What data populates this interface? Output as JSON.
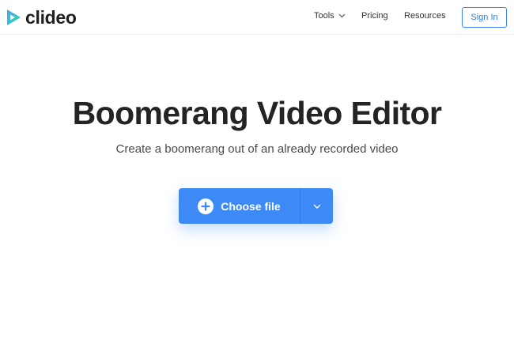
{
  "header": {
    "logo": {
      "text": "clideo",
      "icon": "play-triangle-logo-icon"
    },
    "nav": [
      {
        "label": "Tools",
        "icon": "chevron-down-icon"
      },
      {
        "label": "Pricing"
      },
      {
        "label": "Resources"
      }
    ],
    "signin_label": "Sign In"
  },
  "hero": {
    "title": "Boomerang Video Editor",
    "subtitle": "Create a boomerang out of an already recorded video"
  },
  "upload": {
    "button_label": "Choose file",
    "plus_icon": "plus-circle-icon",
    "menu_icon": "chevron-down-icon"
  },
  "colors": {
    "accent": "#3d8af7",
    "signin_border": "#3b82f6",
    "text": "#242424"
  }
}
